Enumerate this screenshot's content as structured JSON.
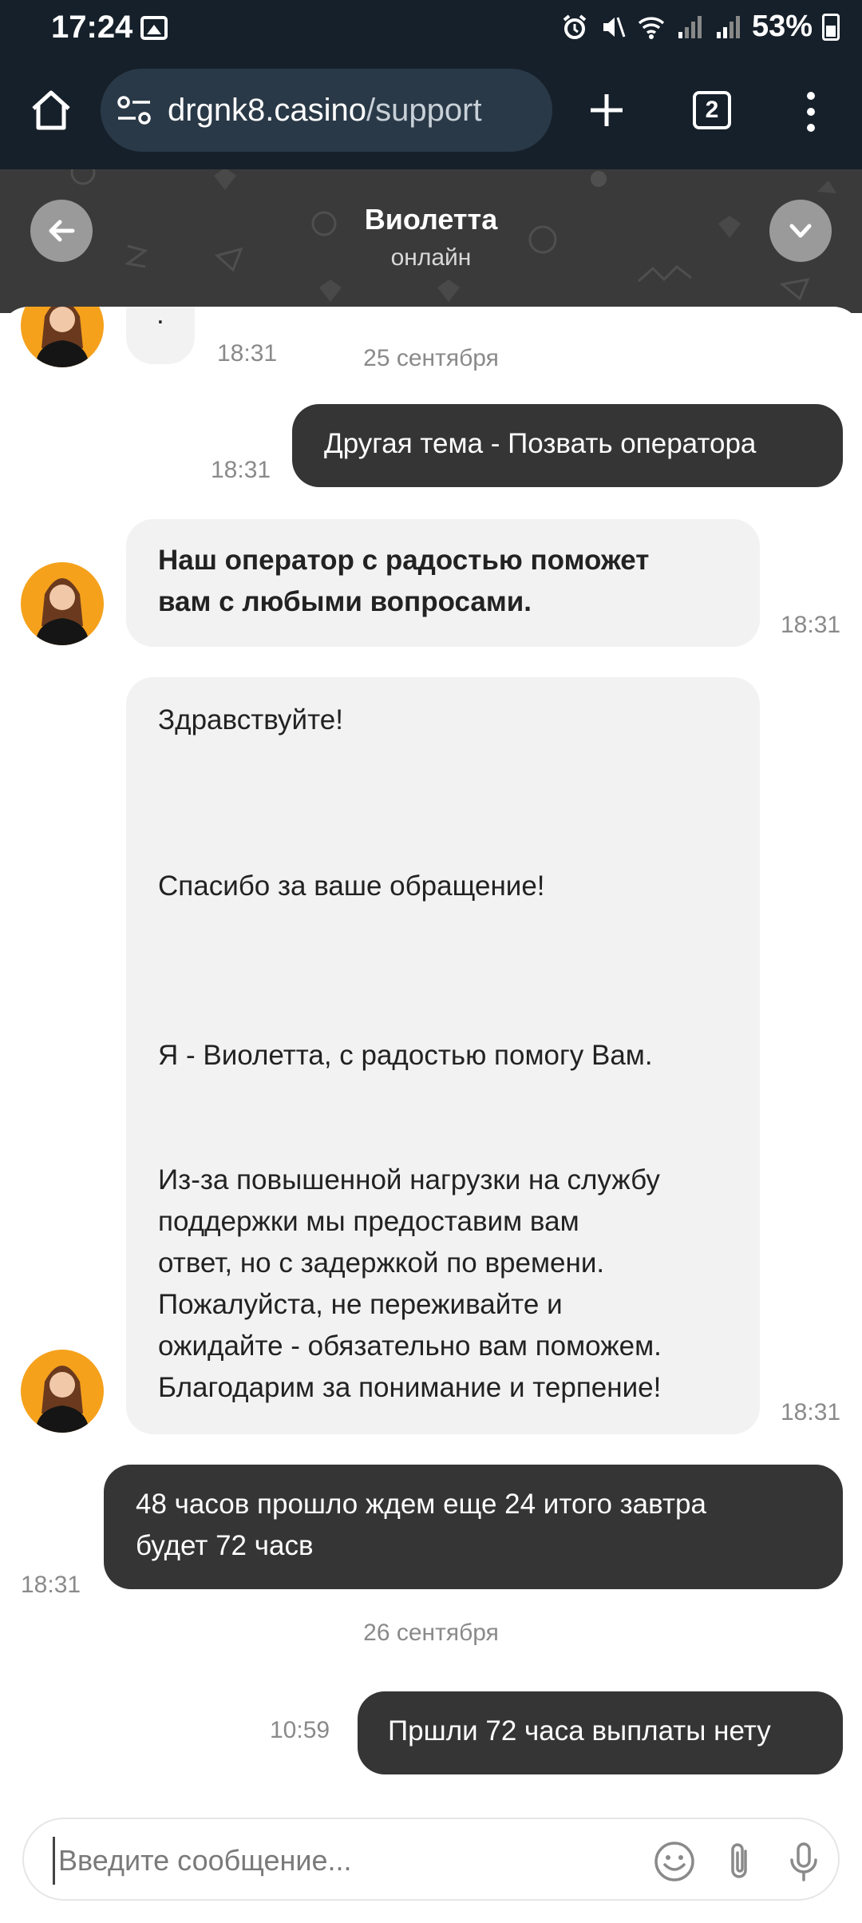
{
  "status_bar": {
    "time": "17:24",
    "battery": "53%",
    "icons": [
      "image-icon",
      "alarm-icon",
      "mute-icon",
      "wifi-icon",
      "signal-icon",
      "signal-icon",
      "battery-icon"
    ]
  },
  "browser": {
    "url_host": "drgnk8.casino",
    "url_path": "/support",
    "tab_count": "2"
  },
  "chat_header": {
    "name": "Виолетта",
    "status": "онлайн"
  },
  "messages": {
    "m0": {
      "text": ".",
      "time": "18:31"
    },
    "date1": "25 сентября",
    "m1": {
      "text": "Другая тема - Позвать оператора",
      "time": "18:31"
    },
    "m2": {
      "line1": "Наш оператор с радостью поможет",
      "line2": "вам с любыми вопросами.",
      "time": "18:31"
    },
    "m3": {
      "p1": "Здравствуйте!",
      "p2": "Спасибо за ваше обращение!",
      "p3": "Я - Виолетта, с радостью помогу Вам.",
      "p4_l1": "Из-за повышенной нагрузки на службу",
      "p4_l2": "поддержки мы предоставим вам",
      "p4_l3": "ответ, но с задержкой по времени.",
      "p4_l4": "Пожалуйста, не переживайте и",
      "p4_l5": "ожидайте - обязательно вам поможем.",
      "p4_l6": "Благодарим за понимание и терпение!",
      "time": "18:31"
    },
    "m4": {
      "line1": "48 часов прошло ждем еще 24 итого завтра",
      "line2": "будет 72 часв",
      "time": "18:31"
    },
    "date2": "26 сентября",
    "m5": {
      "text": "Пршли 72 часа выплаты нету",
      "time": "10:59"
    }
  },
  "composer": {
    "placeholder": "Введите сообщение..."
  },
  "colors": {
    "browser_bg": "#16202a",
    "header_bg": "#3a3a3a",
    "incoming_bubble": "#f2f2f2",
    "outgoing_bubble": "#353535",
    "avatar_bg": "#f5a11c"
  }
}
